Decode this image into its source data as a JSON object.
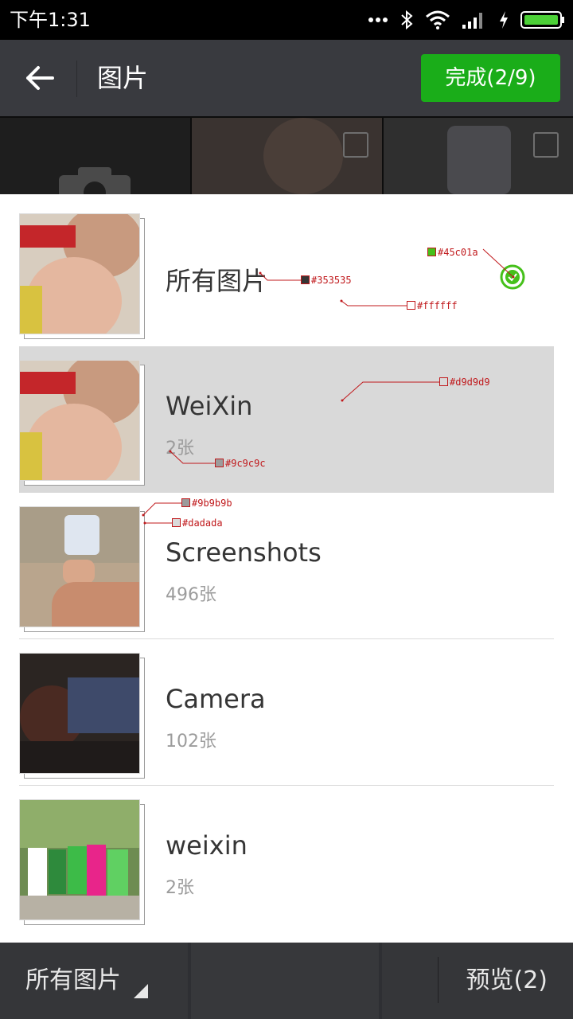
{
  "status_bar": {
    "time": "下午1:31",
    "icons": [
      "more-dots-icon",
      "bluetooth-icon",
      "wifi-icon",
      "signal-icon",
      "charging-icon",
      "battery-icon"
    ]
  },
  "header": {
    "title": "图片",
    "done_label": "完成(2/9)"
  },
  "albums": [
    {
      "name": "所有图片",
      "count": "",
      "selected": true
    },
    {
      "name": "WeiXin",
      "count": "2张",
      "selected": false
    },
    {
      "name": "Screenshots",
      "count": "496张",
      "selected": false
    },
    {
      "name": "Camera",
      "count": "102张",
      "selected": false
    },
    {
      "name": "weixin",
      "count": "2张",
      "selected": false
    }
  ],
  "annotations": {
    "check": "#45c01a",
    "name_color": "#353535",
    "bg_white": "#ffffff",
    "selected_bg": "#d9d9d9",
    "count_color": "#9c9c9c",
    "thumb_border_outer": "#9b9b9b",
    "thumb_border_inner": "#dadada"
  },
  "footer": {
    "dir_label": "所有图片",
    "preview_label": "预览(2)"
  },
  "colors": {
    "accent_green": "#1aad19",
    "header_bg": "#393a3f",
    "check_green": "#45c01a"
  }
}
